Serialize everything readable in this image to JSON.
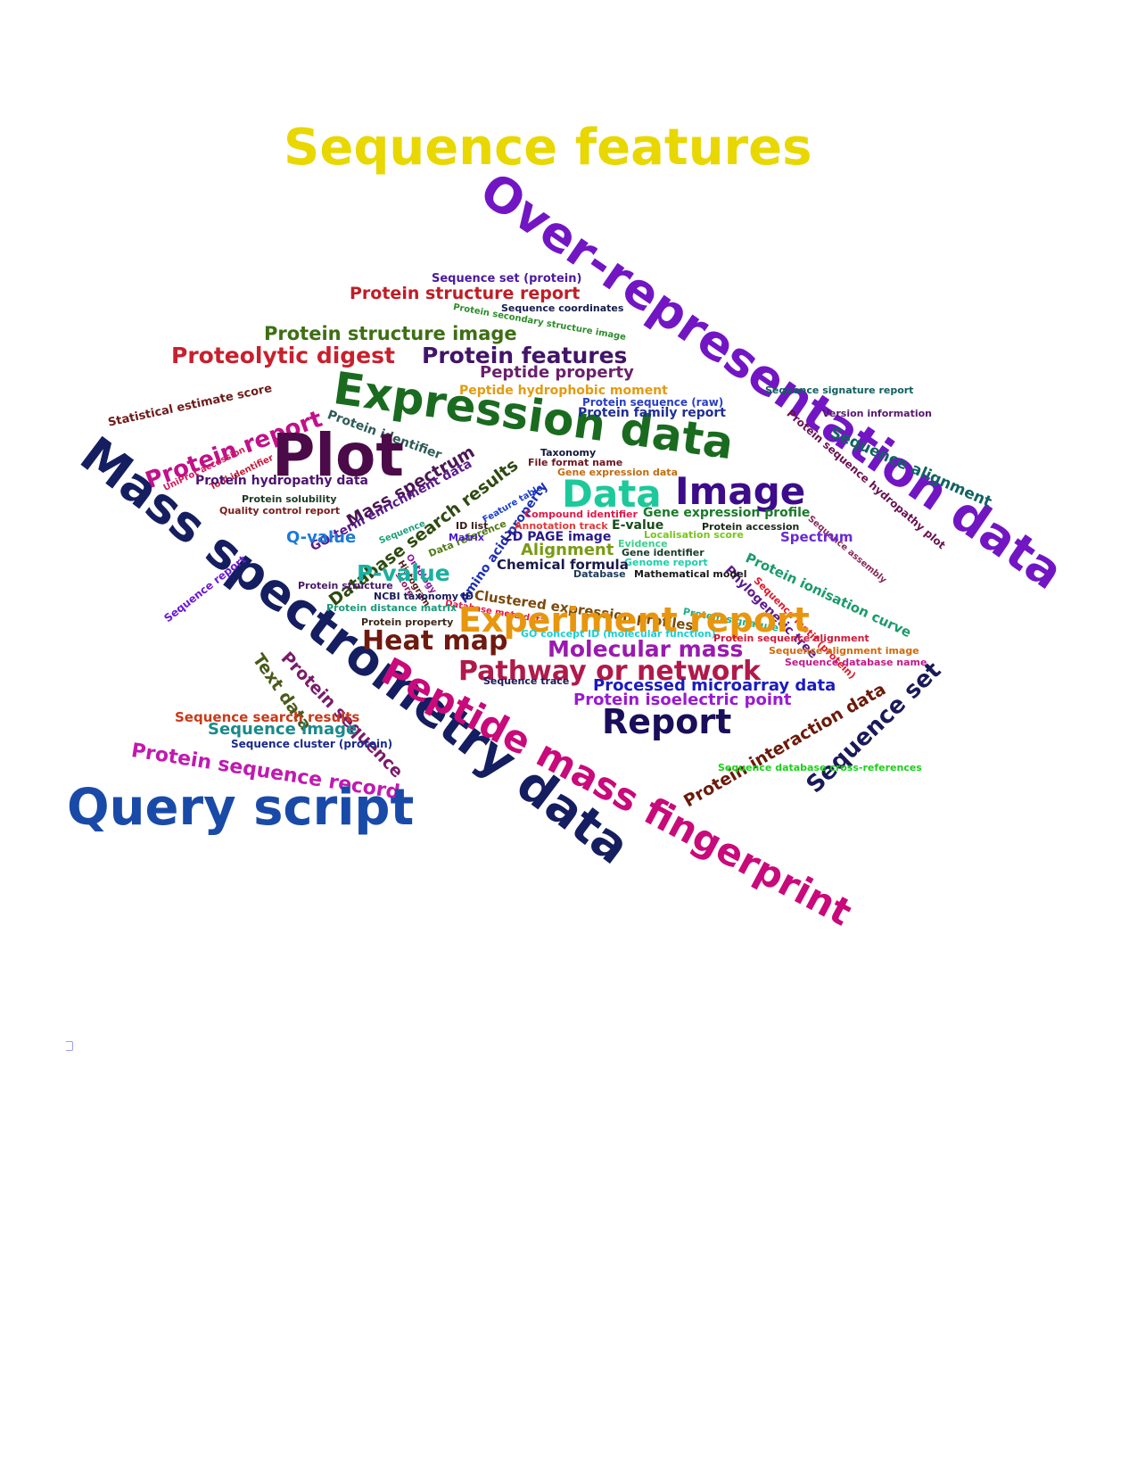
{
  "words": [
    {
      "text": "Sequence features",
      "color": "#e8d700"
    },
    {
      "text": "Over-representation data",
      "color": "#7216c4"
    },
    {
      "text": "Sequence set (protein)",
      "color": "#4b1a9e"
    },
    {
      "text": "Protein structure report",
      "color": "#c01d25"
    },
    {
      "text": "Sequence coordinates",
      "color": "#161c4e"
    },
    {
      "text": "Protein secondary structure image",
      "color": "#2d8c2a"
    },
    {
      "text": "Protein structure image",
      "color": "#3e6e14"
    },
    {
      "text": "Proteolytic digest",
      "color": "#c8202d"
    },
    {
      "text": "Protein features",
      "color": "#421468"
    },
    {
      "text": "Peptide property",
      "color": "#6b1f6c"
    },
    {
      "text": "Statistical estimate score",
      "color": "#6e1a1a"
    },
    {
      "text": "Protein report",
      "color": "#c1118a"
    },
    {
      "text": "Expression data",
      "color": "#1a6b20"
    },
    {
      "text": "Peptide hydrophobic moment",
      "color": "#e39b11"
    },
    {
      "text": "Sequence signature report",
      "color": "#106060"
    },
    {
      "text": "Protein sequence (raw)",
      "color": "#2a3fc2"
    },
    {
      "text": "Protein family report",
      "color": "#1f2f94"
    },
    {
      "text": "Version information",
      "color": "#58176e"
    },
    {
      "text": "Protein identifier",
      "color": "#2c5a56"
    },
    {
      "text": "Protein sequence hydropathy plot",
      "color": "#6a1050"
    },
    {
      "text": "Sequence alignment",
      "color": "#106262"
    },
    {
      "text": "UniProt accession",
      "color": "#d11a5e"
    },
    {
      "text": "Tool identifier",
      "color": "#c81a3a"
    },
    {
      "text": "Plot",
      "color": "#4b0a48"
    },
    {
      "text": "Mass spectrum",
      "color": "#4b1752"
    },
    {
      "text": "Taxonomy",
      "color": "#101840"
    },
    {
      "text": "File format name",
      "color": "#6e1520"
    },
    {
      "text": "Gene expression data",
      "color": "#c06d10"
    },
    {
      "text": "Protein hydropathy data",
      "color": "#4e1470"
    },
    {
      "text": "GO-term enrichment data",
      "color": "#5a1a8a"
    },
    {
      "text": "Database search results",
      "color": "#2e4a10"
    },
    {
      "text": "Feature table",
      "color": "#1b3ed0"
    },
    {
      "text": "Data",
      "color": "#1dc99a"
    },
    {
      "text": "Image",
      "color": "#3c0c8a"
    },
    {
      "text": "Protein solubility",
      "color": "#1c3a24"
    },
    {
      "text": "Quality control report",
      "color": "#7a1a1a"
    },
    {
      "text": "Sequence",
      "color": "#1aa07a"
    },
    {
      "text": "Data reference",
      "color": "#4e7a14"
    },
    {
      "text": "Amino acid property",
      "color": "#1e30b0"
    },
    {
      "text": "Compound identifier",
      "color": "#e0184a"
    },
    {
      "text": "Gene expression profile",
      "color": "#1a7a2a"
    },
    {
      "text": "Sequence assembly",
      "color": "#8a2a5a"
    },
    {
      "text": "Mass spectrometry data",
      "color": "#141e60"
    },
    {
      "text": "Sequence report",
      "color": "#6a1ad0"
    },
    {
      "text": "Q-value",
      "color": "#1a7ad8"
    },
    {
      "text": "ID list",
      "color": "#3a1a1a"
    },
    {
      "text": "Annotation track",
      "color": "#e23a3a"
    },
    {
      "text": "E-value",
      "color": "#1a4a1a"
    },
    {
      "text": "Protein accession",
      "color": "#1a2a1a"
    },
    {
      "text": "Localisation score",
      "color": "#7ac41a"
    },
    {
      "text": "Matrix",
      "color": "#4a1ad0"
    },
    {
      "text": "2D PAGE image",
      "color": "#2a1a8a"
    },
    {
      "text": "Evidence",
      "color": "#3ad08a"
    },
    {
      "text": "Spectrum",
      "color": "#6a2ad0"
    },
    {
      "text": "Protein ionisation curve",
      "color": "#1a9a6a"
    },
    {
      "text": "Ontology",
      "color": "#8a1aa0"
    },
    {
      "text": "Histogram",
      "color": "#5a1a1a"
    },
    {
      "text": "score",
      "color": "#8a1a6a"
    },
    {
      "text": "Alignment",
      "color": "#7a9a14"
    },
    {
      "text": "Gene identifier",
      "color": "#1a3a2a"
    },
    {
      "text": "Genome report",
      "color": "#1acfaa"
    },
    {
      "text": "Phylogenetic tree",
      "color": "#5a1a8a"
    },
    {
      "text": "P-value",
      "color": "#1ab0a0"
    },
    {
      "text": "Chemical formula",
      "color": "#1a1a4a"
    },
    {
      "text": "Sequence motif (protein)",
      "color": "#e01a2a"
    },
    {
      "text": "Database",
      "color": "#1a3a5a"
    },
    {
      "text": "Mathematical model",
      "color": "#1a1a1a"
    },
    {
      "text": "Clustered expression profiles",
      "color": "#7a4a0a"
    },
    {
      "text": "Protein signature",
      "color": "#1ab08a"
    },
    {
      "text": "Protein structure",
      "color": "#4a1a6a"
    },
    {
      "text": "Database meta data",
      "color": "#e0184a"
    },
    {
      "text": "NCBI taxonomy ID",
      "color": "#1a1a5a"
    },
    {
      "text": "Protein distance matrix",
      "color": "#1a9a7a"
    },
    {
      "text": "Experiment report",
      "color": "#e8960e"
    },
    {
      "text": "Protein property",
      "color": "#3a2a1a"
    },
    {
      "text": "GO concept ID (molecular function)",
      "color": "#1ad0d0"
    },
    {
      "text": "Protein sequence alignment",
      "color": "#d01a3a"
    },
    {
      "text": "Heat map",
      "color": "#6e1a10"
    },
    {
      "text": "Molecular mass",
      "color": "#9a1ab0"
    },
    {
      "text": "Sequence alignment image",
      "color": "#d06a0a"
    },
    {
      "text": "Sequence database name",
      "color": "#c01a8a"
    },
    {
      "text": "Text data",
      "color": "#4a5a1a"
    },
    {
      "text": "Protein sequence",
      "color": "#7a1a6a"
    },
    {
      "text": "Pathway or network",
      "color": "#b01a4a"
    },
    {
      "text": "Peptide mass fingerprint",
      "color": "#c80a7a"
    },
    {
      "text": "Sequence trace",
      "color": "#1a1a5a"
    },
    {
      "text": "Processed microarray data",
      "color": "#1a1ac0"
    },
    {
      "text": "Protein isoelectric point",
      "color": "#9a1ad0"
    },
    {
      "text": "Sequence set",
      "color": "#1a1a5a"
    },
    {
      "text": "Protein interaction data",
      "color": "#6a1a0a"
    },
    {
      "text": "Report",
      "color": "#1a0e5a"
    },
    {
      "text": "Sequence search results",
      "color": "#c83a1a"
    },
    {
      "text": "Sequence image",
      "color": "#1a8a8a"
    },
    {
      "text": "Sequence cluster (protein)",
      "color": "#1a2a8a"
    },
    {
      "text": "Protein sequence record",
      "color": "#c01ab0"
    },
    {
      "text": "Sequence database cross-references",
      "color": "#1ad01a"
    },
    {
      "text": "Query script",
      "color": "#1a4aa8"
    }
  ]
}
